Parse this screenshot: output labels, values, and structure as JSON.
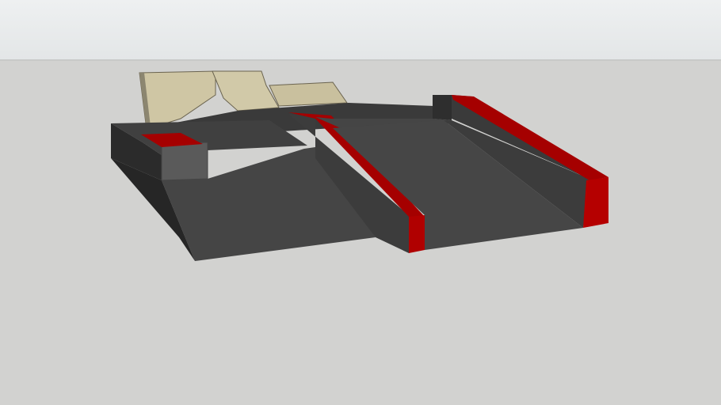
{
  "viewport": {
    "sky_color": "#e9ecee",
    "ground_color": "#d2d2d0"
  },
  "model": {
    "name": "",
    "colors": {
      "concrete_top": "#3d3d3d",
      "concrete_side": "#2f2f2f",
      "concrete_light": "#555555",
      "wood": "#cfc6a4",
      "rail": "#a50000",
      "rail_dark": "#7a0000"
    }
  }
}
